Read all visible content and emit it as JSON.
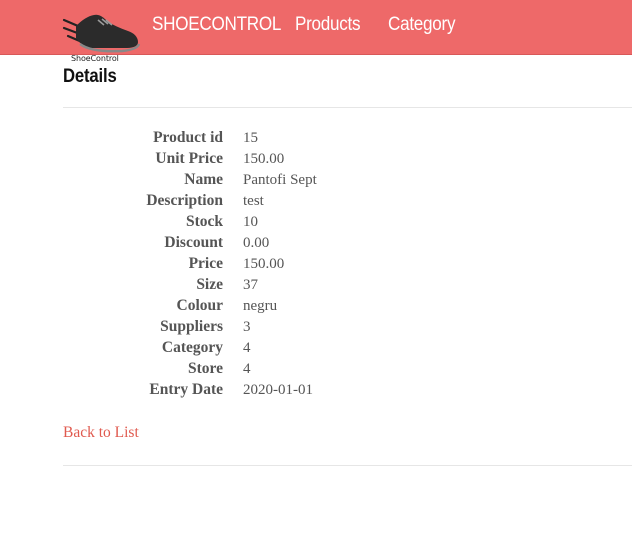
{
  "brand": {
    "name": "ShoeControl",
    "icon": "sneaker-logo-icon"
  },
  "nav": {
    "home": "SHOECONTROL",
    "products": "Products",
    "category": "Category"
  },
  "page": {
    "title": "Details"
  },
  "details": [
    {
      "label": "Product id",
      "value": "15"
    },
    {
      "label": "Unit Price",
      "value": "150.00"
    },
    {
      "label": "Name",
      "value": "Pantofi Sept"
    },
    {
      "label": "Description",
      "value": "test"
    },
    {
      "label": "Stock",
      "value": "10"
    },
    {
      "label": "Discount",
      "value": "0.00"
    },
    {
      "label": "Price",
      "value": "150.00"
    },
    {
      "label": "Size",
      "value": "37"
    },
    {
      "label": "Colour",
      "value": "negru"
    },
    {
      "label": "Suppliers",
      "value": "3"
    },
    {
      "label": "Category",
      "value": "4"
    },
    {
      "label": "Store",
      "value": "4"
    },
    {
      "label": "Entry Date",
      "value": "2020-01-01"
    }
  ],
  "actions": {
    "back": "Back to List"
  },
  "colors": {
    "navbar": "#ee6969",
    "link": "#e05a4f",
    "text": "#555555"
  }
}
